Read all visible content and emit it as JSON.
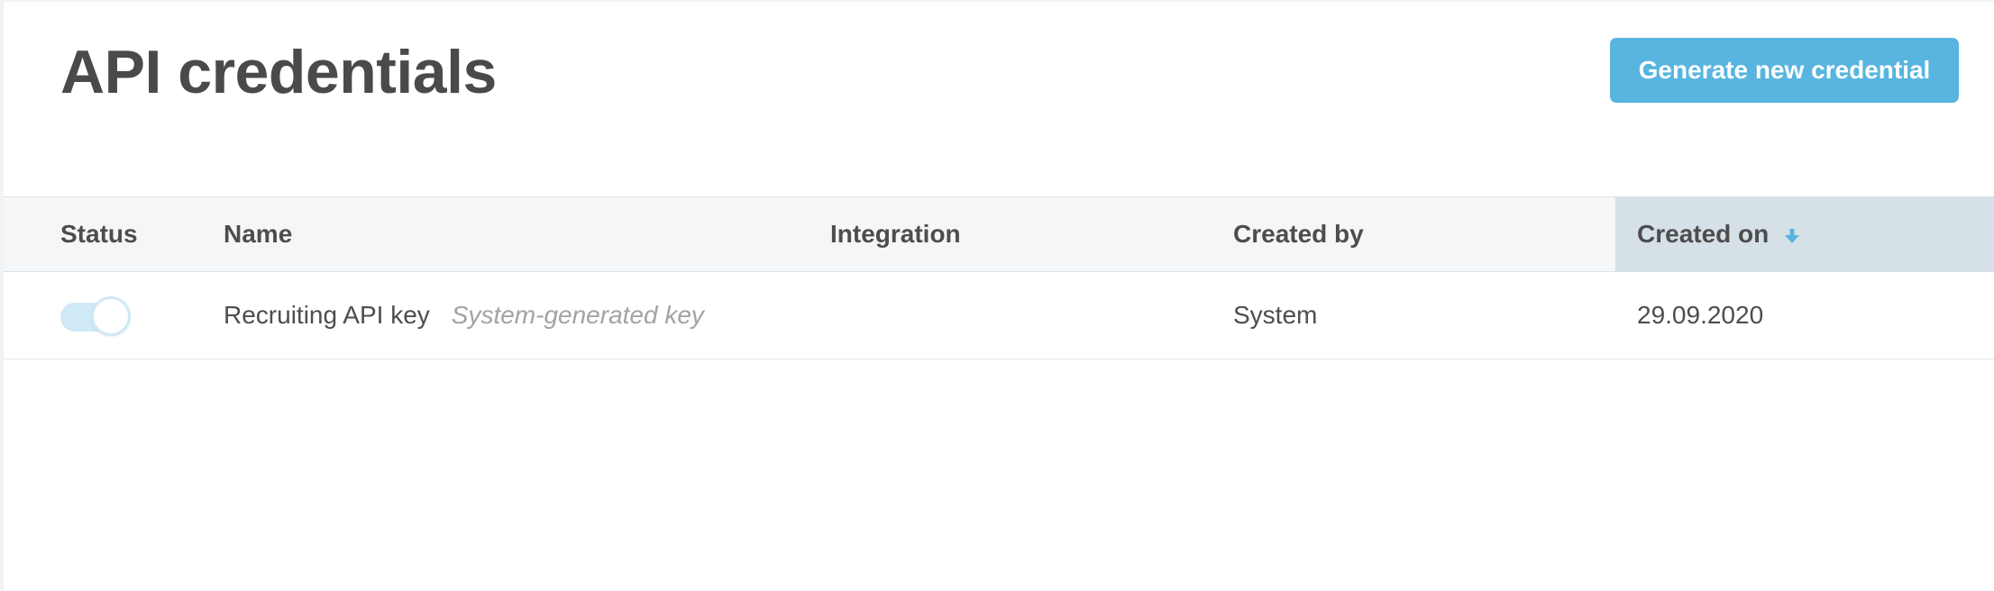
{
  "header": {
    "title": "API credentials",
    "generate_button_label": "Generate new credential"
  },
  "colors": {
    "accent": "#57b5df",
    "sorted_column_bg": "#d5e0e7",
    "toggle_on": "#cfe9f6"
  },
  "table": {
    "columns": [
      {
        "label": "Status"
      },
      {
        "label": "Name"
      },
      {
        "label": "Integration"
      },
      {
        "label": "Created by"
      },
      {
        "label": "Created on",
        "sort": "descending",
        "sort_icon": "arrow-down-icon"
      }
    ],
    "rows": [
      {
        "status_enabled": true,
        "name": "Recruiting API key",
        "name_note": "System-generated key",
        "integration": "",
        "created_by": "System",
        "created_on": "29.09.2020"
      }
    ]
  }
}
